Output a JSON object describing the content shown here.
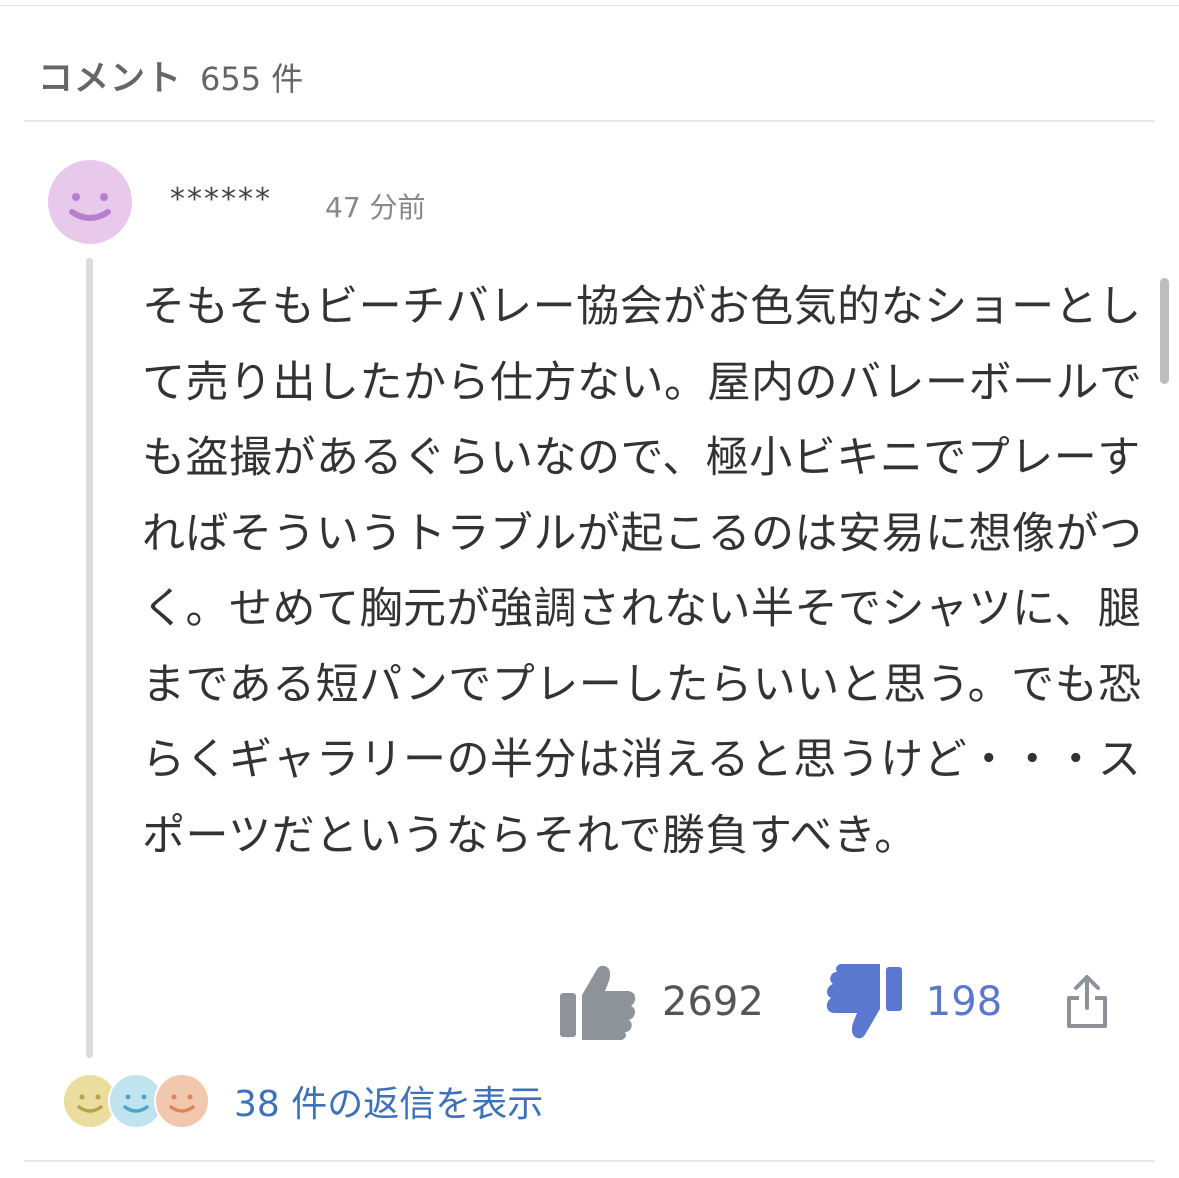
{
  "header": {
    "title": "コメント",
    "count": "655 件"
  },
  "comment": {
    "username": "******",
    "time": "47 分前",
    "body": "そもそもビーチバレー協会がお色気的なショーとして売り出したから仕方ない。屋内のバレーボールでも盗撮があるぐらいなので、極小ビキニでプレーすればそういうトラブルが起こるのは安易に想像がつく。せめて胸元が強調されない半そでシャツに、腿まである短パンでプレーしたらいいと思う。でも恐らくギャラリーの半分は消えると思うけど・・・スポーツだというならそれで勝負すべき。",
    "likes": "2692",
    "dislikes": "198",
    "replies_label": "38 件の返信を表示"
  },
  "colors": {
    "avatar": "#e8c9ec",
    "avatar_face": "#b87fd0",
    "dislike": "#5b78cf",
    "link": "#3d72b8",
    "like": "#8e939a",
    "mini_avatars": [
      "#eadd9e",
      "#bfe3ef",
      "#f1c7ad"
    ]
  },
  "icons": [
    "smiley-avatar-icon",
    "thumbs-up-icon",
    "thumbs-down-icon",
    "share-icon"
  ]
}
